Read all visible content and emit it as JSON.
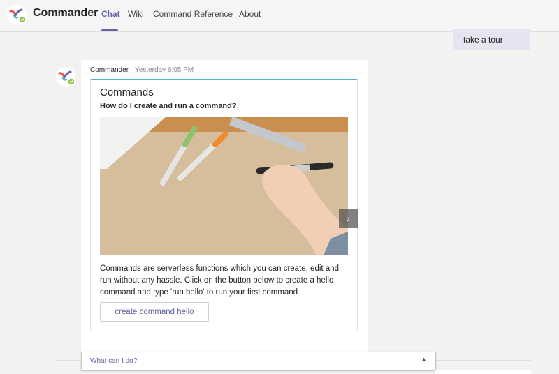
{
  "header": {
    "app_name": "Commander",
    "tabs": [
      {
        "label": "Chat",
        "active": true
      },
      {
        "label": "Wiki",
        "active": false
      },
      {
        "label": "Command Reference",
        "active": false
      },
      {
        "label": "About",
        "active": false
      }
    ],
    "accent_color": "#6264a7"
  },
  "chat": {
    "previous_user_message": "take a tour",
    "bot_message": {
      "sender": "Commander",
      "timestamp": "Yesterday 6:05 PM",
      "card": {
        "title": "Commands",
        "subtitle": "How do I create and run a command?",
        "image_alt": "hand writing with marker on paper",
        "body": "Commands are serverless functions which you can create, edit and run without any hassle. Click on the button below to create a hello command and type 'run hello' to run your first command",
        "button_label": "create command hello",
        "carousel_next_icon": "chevron-right-icon"
      }
    }
  },
  "compose": {
    "suggestion": "What can I do?",
    "collapse_icon": "caret-up-icon"
  }
}
